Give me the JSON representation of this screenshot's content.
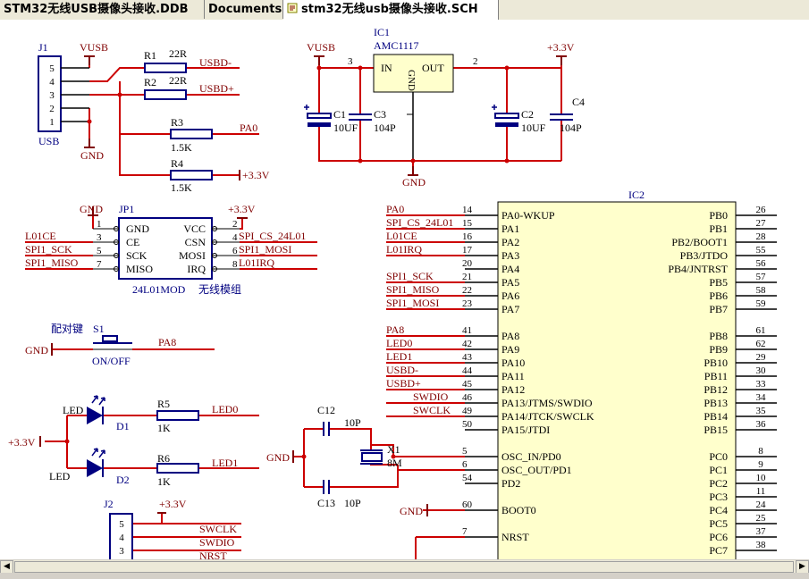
{
  "tabs": [
    {
      "label": "STM32无线USB摄像头接收.DDB",
      "active": false
    },
    {
      "label": "Documents",
      "active": false
    },
    {
      "label": "stm32无线usb摄像头接收.SCH",
      "active": true
    }
  ],
  "colors": {
    "wire": "#cc0000",
    "component": "#000080",
    "body_fill": "#ffffcc",
    "pin": "#000000",
    "text": "#000080",
    "label": "#800000",
    "power": "#800000",
    "background": "#ffffff"
  },
  "schematic": {
    "usb": {
      "ref": "J1",
      "name": "USB",
      "pins": [
        "5",
        "4",
        "3",
        "2",
        "1"
      ],
      "vusb": "VUSB",
      "gnd": "GND"
    },
    "resistors": [
      {
        "ref": "R1",
        "value": "22R",
        "net": "USBD-"
      },
      {
        "ref": "R2",
        "value": "22R",
        "net": "USBD+"
      },
      {
        "ref": "R3",
        "value": "1.5K",
        "net": "PA0"
      },
      {
        "ref": "R4",
        "value": "1.5K",
        "net": "+3.3V"
      },
      {
        "ref": "R5",
        "value": "1K",
        "net": "LED0"
      },
      {
        "ref": "R6",
        "value": "1K",
        "net": "LED1"
      }
    ],
    "regulator": {
      "ref": "IC1",
      "part": "AMC1117",
      "in": "IN",
      "out": "OUT",
      "gnd": "GND",
      "pin_in": "3",
      "pin_out": "2",
      "vin": "VUSB",
      "vout": "+3.3V",
      "ground": "GND"
    },
    "caps": [
      {
        "ref": "C1",
        "value": "10UF"
      },
      {
        "ref": "C3",
        "value": "104P"
      },
      {
        "ref": "C2",
        "value": "10UF"
      },
      {
        "ref": "C4",
        "value": "104P"
      },
      {
        "ref": "C12",
        "value": "10P"
      },
      {
        "ref": "C13",
        "value": "10P"
      }
    ],
    "radio": {
      "ref": "JP1",
      "part": "24L01MOD",
      "desc": "无线模组",
      "left_pins": [
        "GND",
        "CE",
        "SCK",
        "MISO"
      ],
      "left_nums": [
        "1",
        "3",
        "5",
        "7"
      ],
      "right_pins": [
        "VCC",
        "CSN",
        "MOSI",
        "IRQ"
      ],
      "right_nums": [
        "2",
        "4",
        "6",
        "8"
      ],
      "left_nets": [
        "",
        "L01CE",
        "SPI1_SCK",
        "SPI1_MISO"
      ],
      "right_nets": [
        "+3.3V",
        "SPI_CS_24L01",
        "SPI1_MOSI",
        "L01IRQ"
      ],
      "top_left": "GND",
      "top_right": "+3.3V"
    },
    "switch": {
      "ref": "S1",
      "label": "配对键",
      "state": "ON/OFF",
      "gnd": "GND",
      "net": "PA8"
    },
    "leds": [
      {
        "label": "LED",
        "ref": "D1"
      },
      {
        "label": "LED",
        "ref": "D2"
      }
    ],
    "led_supply": "+3.3V",
    "crystal": {
      "ref": "X1",
      "value": "8M",
      "gnd": "GND"
    },
    "swd": {
      "ref": "J2",
      "pins": [
        "5",
        "4",
        "3"
      ],
      "nets": [
        "+3.3V",
        "SWCLK",
        "SWDIO",
        "NRST"
      ]
    },
    "mcu": {
      "ref": "IC2",
      "left": [
        {
          "net": "PA0",
          "num": "14",
          "name": "PA0-WKUP"
        },
        {
          "net": "SPI_CS_24L01",
          "num": "15",
          "name": "PA1"
        },
        {
          "net": "L01CE",
          "num": "16",
          "name": "PA2"
        },
        {
          "net": "L01IRQ",
          "num": "17",
          "name": "PA3"
        },
        {
          "net": "",
          "num": "20",
          "name": "PA4"
        },
        {
          "net": "SPI1_SCK",
          "num": "21",
          "name": "PA5"
        },
        {
          "net": "SPI1_MISO",
          "num": "22",
          "name": "PA6"
        },
        {
          "net": "SPI1_MOSI",
          "num": "23",
          "name": "PA7"
        },
        {
          "net": "PA8",
          "num": "41",
          "name": "PA8"
        },
        {
          "net": "LED0",
          "num": "42",
          "name": "PA9"
        },
        {
          "net": "LED1",
          "num": "43",
          "name": "PA10"
        },
        {
          "net": "USBD-",
          "num": "44",
          "name": "PA11"
        },
        {
          "net": "USBD+",
          "num": "45",
          "name": "PA12"
        },
        {
          "net": "SWDIO",
          "num": "46",
          "name": "PA13/JTMS/SWDIO"
        },
        {
          "net": "SWCLK",
          "num": "49",
          "name": "PA14/JTCK/SWCLK"
        },
        {
          "net": "",
          "num": "50",
          "name": "PA15/JTDI"
        },
        {
          "net": "",
          "num": "5",
          "name": "OSC_IN/PD0"
        },
        {
          "net": "",
          "num": "6",
          "name": "OSC_OUT/PD1"
        },
        {
          "net": "",
          "num": "54",
          "name": "PD2"
        },
        {
          "net": "GND",
          "num": "60",
          "name": "BOOT0"
        },
        {
          "net": "",
          "num": "7",
          "name": "NRST"
        }
      ],
      "right": [
        {
          "num": "26",
          "name": "PB0"
        },
        {
          "num": "27",
          "name": "PB1"
        },
        {
          "num": "28",
          "name": "PB2/BOOT1"
        },
        {
          "num": "55",
          "name": "PB3/JTDO"
        },
        {
          "num": "56",
          "name": "PB4/JNTRST"
        },
        {
          "num": "57",
          "name": "PB5"
        },
        {
          "num": "58",
          "name": "PB6"
        },
        {
          "num": "59",
          "name": "PB7"
        },
        {
          "num": "61",
          "name": "PB8"
        },
        {
          "num": "62",
          "name": "PB9"
        },
        {
          "num": "29",
          "name": "PB10"
        },
        {
          "num": "30",
          "name": "PB11"
        },
        {
          "num": "33",
          "name": "PB12"
        },
        {
          "num": "34",
          "name": "PB13"
        },
        {
          "num": "35",
          "name": "PB14"
        },
        {
          "num": "36",
          "name": "PB15"
        },
        {
          "num": "8",
          "name": "PC0"
        },
        {
          "num": "9",
          "name": "PC1"
        },
        {
          "num": "10",
          "name": "PC2"
        },
        {
          "num": "11",
          "name": "PC3"
        },
        {
          "num": "24",
          "name": "PC4"
        },
        {
          "num": "25",
          "name": "PC5"
        },
        {
          "num": "37",
          "name": "PC6"
        },
        {
          "num": "38",
          "name": "PC7"
        }
      ]
    }
  },
  "icons": {
    "sch_tab": "schematic-document-icon",
    "scroll_left": "arrow-left-icon",
    "scroll_right": "arrow-right-icon"
  }
}
